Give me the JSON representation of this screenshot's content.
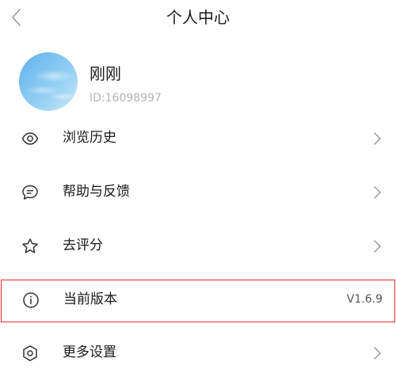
{
  "header": {
    "title": "个人中心",
    "back_icon": "chevron-left-icon"
  },
  "profile": {
    "name": "刚刚",
    "id_text": "ID:16098997",
    "avatar": "sky-avatar"
  },
  "menu": [
    {
      "label": "浏览历史",
      "icon": "eye-icon"
    },
    {
      "label": "帮助与反馈",
      "icon": "chat-bubble-icon"
    },
    {
      "label": "去评分",
      "icon": "star-icon"
    },
    {
      "label": "当前版本",
      "icon": "info-icon",
      "value": "V1.6.9",
      "highlighted": true
    },
    {
      "label": "更多设置",
      "icon": "settings-hexagon-icon"
    }
  ],
  "colors": {
    "highlight_border": "#e02b2b",
    "icon_stroke": "#333333",
    "chevron": "#9a9a9a",
    "id_text": "#b4b4b4",
    "avatar_sky": "#7ec3ef"
  }
}
